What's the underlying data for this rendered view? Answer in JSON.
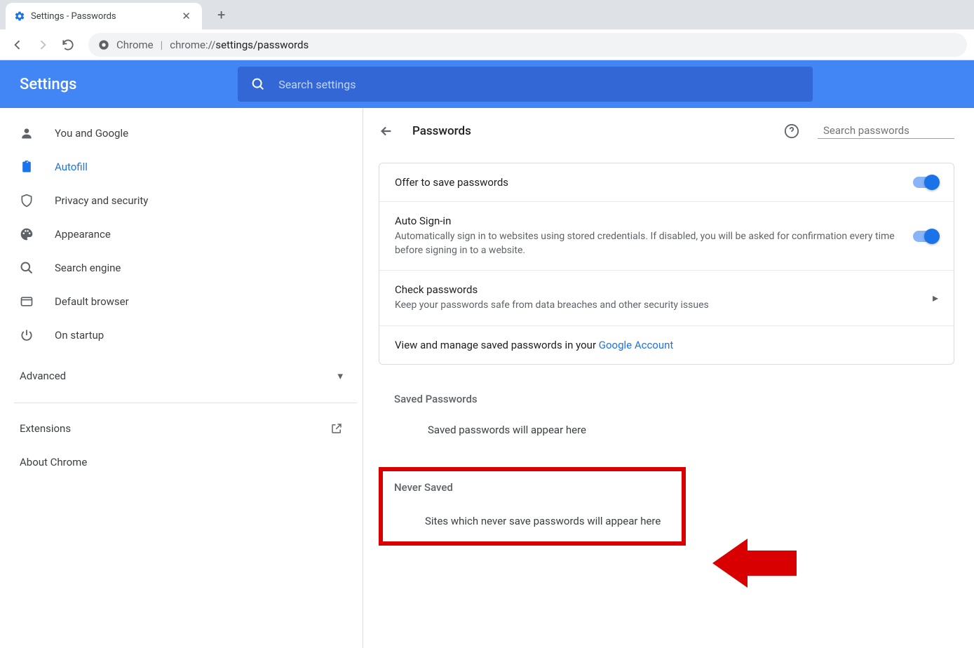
{
  "browser": {
    "tab_title": "Settings - Passwords",
    "address_label": "Chrome",
    "url_muted_prefix": "chrome://",
    "url_strong": "settings/passwords"
  },
  "header": {
    "title": "Settings",
    "search_placeholder": "Search settings"
  },
  "sidebar": {
    "items": [
      {
        "label": "You and Google"
      },
      {
        "label": "Autofill"
      },
      {
        "label": "Privacy and security"
      },
      {
        "label": "Appearance"
      },
      {
        "label": "Search engine"
      },
      {
        "label": "Default browser"
      },
      {
        "label": "On startup"
      }
    ],
    "advanced": "Advanced",
    "extensions": "Extensions",
    "about": "About Chrome"
  },
  "main": {
    "title": "Passwords",
    "pw_search_placeholder": "Search passwords",
    "offer_save": "Offer to save passwords",
    "auto_signin_title": "Auto Sign-in",
    "auto_signin_desc": "Automatically sign in to websites using stored credentials. If disabled, you will be asked for confirmation every time before signing in to a website.",
    "check_pw_title": "Check passwords",
    "check_pw_desc": "Keep your passwords safe from data breaches and other security issues",
    "view_manage_prefix": "View and manage saved passwords in your ",
    "google_account": "Google Account",
    "saved_section": "Saved Passwords",
    "saved_empty": "Saved passwords will appear here",
    "never_section": "Never Saved",
    "never_empty": "Sites which never save passwords will appear here"
  }
}
